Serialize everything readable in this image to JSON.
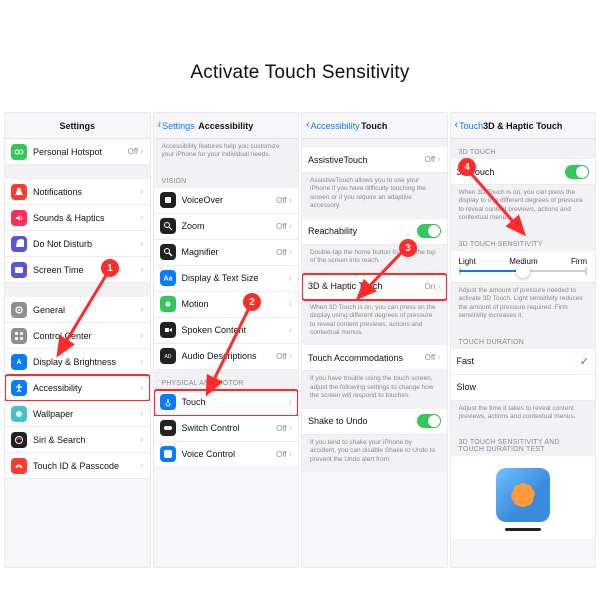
{
  "title": "Activate Touch Sensitivity",
  "annotations": {
    "steps": [
      "1",
      "2",
      "3",
      "4"
    ]
  },
  "panel1": {
    "nav_title": "Settings",
    "rows": [
      {
        "icon": "personal-hotspot-icon",
        "bg": "#34c759",
        "label": "Personal Hotspot",
        "value": "Off"
      }
    ],
    "group2": [
      {
        "icon": "notifications-icon",
        "bg": "#ff3b30",
        "label": "Notifications"
      },
      {
        "icon": "sounds-icon",
        "bg": "#ff2d55",
        "label": "Sounds & Haptics"
      },
      {
        "icon": "dnd-icon",
        "bg": "#5856d6",
        "label": "Do Not Disturb"
      },
      {
        "icon": "screentime-icon",
        "bg": "#5856d6",
        "label": "Screen Time"
      }
    ],
    "group3": [
      {
        "icon": "general-icon",
        "bg": "#8e8e93",
        "label": "General"
      },
      {
        "icon": "controlcenter-icon",
        "bg": "#8e8e93",
        "label": "Control Center"
      },
      {
        "icon": "display-icon",
        "bg": "#0a7aff",
        "label": "Display & Brightness"
      },
      {
        "icon": "accessibility-icon",
        "bg": "#0a7aff",
        "label": "Accessibility",
        "highlight": true
      },
      {
        "icon": "wallpaper-icon",
        "bg": "#44c2c9",
        "label": "Wallpaper"
      },
      {
        "icon": "siri-icon",
        "bg": "#222",
        "label": "Siri & Search"
      },
      {
        "icon": "touchid-icon",
        "bg": "#ff3b30",
        "label": "Touch ID & Passcode"
      }
    ]
  },
  "panel2": {
    "back": "Settings",
    "nav_title": "Accessibility",
    "intro": "Accessibility features help you customize your iPhone for your individual needs.",
    "sec_vision": "VISION",
    "vision": [
      {
        "icon": "voiceover-icon",
        "bg": "#222",
        "label": "VoiceOver",
        "value": "Off"
      },
      {
        "icon": "zoom-icon",
        "bg": "#222",
        "label": "Zoom",
        "value": "Off"
      },
      {
        "icon": "magnifier-icon",
        "bg": "#222",
        "label": "Magnifier",
        "value": "Off"
      },
      {
        "icon": "textsize-icon",
        "bg": "#0a7aff",
        "label": "Display & Text Size"
      },
      {
        "icon": "motion-icon",
        "bg": "#34c759",
        "label": "Motion"
      },
      {
        "icon": "spoken-icon",
        "bg": "#222",
        "label": "Spoken Content"
      },
      {
        "icon": "audiodesc-icon",
        "bg": "#222",
        "label": "Audio Descriptions",
        "value": "Off"
      }
    ],
    "sec_motor": "PHYSICAL AND MOTOR",
    "motor": [
      {
        "icon": "touch-icon",
        "bg": "#0a7aff",
        "label": "Touch",
        "highlight": true
      },
      {
        "icon": "switch-icon",
        "bg": "#222",
        "label": "Switch Control",
        "value": "Off"
      },
      {
        "icon": "voice-icon",
        "bg": "#0a7aff",
        "label": "Voice Control",
        "value": "Off"
      }
    ]
  },
  "panel3": {
    "back": "Accessibility",
    "nav_title": "Touch",
    "rows1": [
      {
        "label": "AssistiveTouch",
        "value": "Off"
      }
    ],
    "note1": "AssistiveTouch allows you to use your iPhone if you have difficulty touching the screen or if you require an adaptive accessory.",
    "reach_label": "Reachability",
    "note2": "Double-tap the home button to bring the top of the screen into reach.",
    "row3d": {
      "label": "3D & Haptic Touch",
      "value": "On"
    },
    "note3": "When 3D Touch is on, you can press on the display using different degrees of pressure to reveal content previews, actions and contextual menus.",
    "rows4": [
      {
        "label": "Touch Accommodations",
        "value": "Off"
      }
    ],
    "note4": "If you have trouble using the touch screen, adjust the following settings to change how the screen will respond to touches.",
    "shake_label": "Shake to Undo",
    "note5": "If you tend to shake your iPhone by accident, you can disable Shake to Undo to prevent the Undo alert from"
  },
  "panel4": {
    "back": "Touch",
    "nav_title": "3D & Haptic Touch",
    "sec1": "3D TOUCH",
    "row1_label": "3D Touch",
    "note1": "When 3D Touch is on, you can press the display to use different degrees of pressure to reveal content previews, actions and contextual menus.",
    "sec2": "3D TOUCH SENSITIVITY",
    "slider": {
      "left": "Light",
      "mid": "Medium",
      "right": "Firm"
    },
    "note2": "Adjust the amount of pressure needed to activate 3D Touch. Light sensitivity reduces the amount of pressure required. Firm sensitivity increases it.",
    "sec3": "TOUCH DURATION",
    "dur": [
      {
        "label": "Fast",
        "checked": true
      },
      {
        "label": "Slow",
        "checked": false
      }
    ],
    "note3": "Adjust the time it takes to reveal content previews, actions and contextual menus.",
    "sec4": "3D TOUCH SENSITIVITY AND TOUCH DURATION TEST"
  }
}
